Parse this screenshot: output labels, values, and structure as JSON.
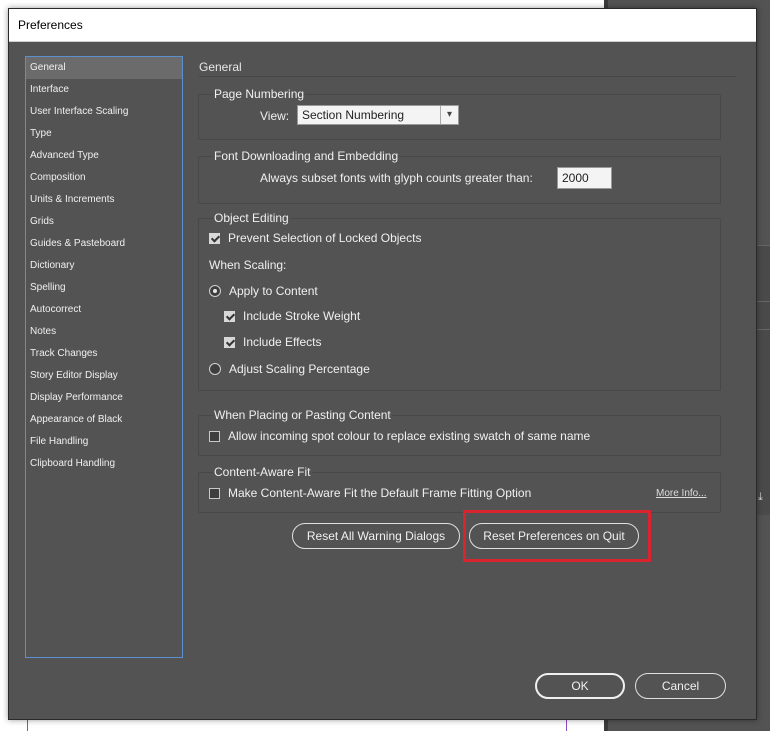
{
  "window": {
    "title": "Preferences"
  },
  "sidebar": {
    "items": [
      {
        "label": "General",
        "selected": true
      },
      {
        "label": "Interface"
      },
      {
        "label": "User Interface Scaling"
      },
      {
        "label": "Type"
      },
      {
        "label": "Advanced Type"
      },
      {
        "label": "Composition"
      },
      {
        "label": "Units & Increments"
      },
      {
        "label": "Grids"
      },
      {
        "label": "Guides & Pasteboard"
      },
      {
        "label": "Dictionary"
      },
      {
        "label": "Spelling"
      },
      {
        "label": "Autocorrect"
      },
      {
        "label": "Notes"
      },
      {
        "label": "Track Changes"
      },
      {
        "label": "Story Editor Display"
      },
      {
        "label": "Display Performance"
      },
      {
        "label": "Appearance of Black"
      },
      {
        "label": "File Handling"
      },
      {
        "label": "Clipboard Handling"
      }
    ]
  },
  "main": {
    "heading": "General",
    "page_numbering": {
      "title": "Page Numbering",
      "view_label": "View:",
      "view_value": "Section Numbering"
    },
    "font_downloading": {
      "title": "Font Downloading and Embedding",
      "subset_label": "Always subset fonts with glyph counts greater than:",
      "subset_value": "2000"
    },
    "object_editing": {
      "title": "Object Editing",
      "prevent_selection_label": "Prevent Selection of Locked Objects",
      "prevent_selection_checked": true,
      "when_scaling_label": "When Scaling:",
      "apply_to_content_label": "Apply to Content",
      "apply_to_content_selected": true,
      "include_stroke_label": "Include Stroke Weight",
      "include_stroke_checked": true,
      "include_effects_label": "Include Effects",
      "include_effects_checked": true,
      "adjust_scaling_label": "Adjust Scaling Percentage",
      "adjust_scaling_selected": false
    },
    "placing": {
      "title": "When Placing or Pasting Content",
      "allow_spot_label": "Allow incoming spot colour to replace existing swatch of same name",
      "allow_spot_checked": false
    },
    "content_aware": {
      "title": "Content-Aware Fit",
      "default_fit_label": "Make Content-Aware Fit the Default Frame Fitting Option",
      "default_fit_checked": false,
      "more_info": "More Info..."
    },
    "buttons": {
      "reset_warnings": "Reset All Warning Dialogs",
      "reset_prefs": "Reset Preferences on Quit"
    }
  },
  "footer": {
    "ok": "OK",
    "cancel": "Cancel"
  },
  "colors": {
    "dialog_bg": "#535353",
    "highlight": "#d9232e",
    "sidebar_border": "#5b8fd0"
  }
}
